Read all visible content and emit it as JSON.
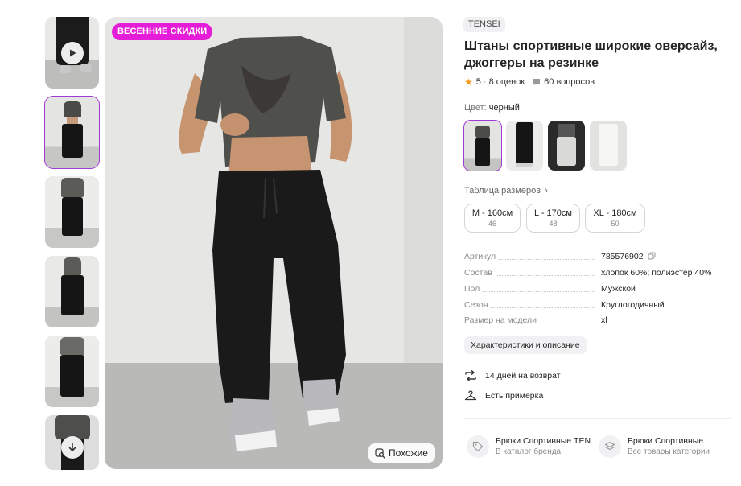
{
  "promo_badge": "ВЕСЕННИЕ СКИДКИ",
  "similar_button": "Похожие",
  "brand": "TENSEI",
  "title": "Штаны спортивные широкие оверсайз, джоггеры на резинке",
  "rating": {
    "value": "5",
    "reviews": "8 оценок",
    "questions": "60 вопросов"
  },
  "color": {
    "label": "Цвет:",
    "value": "черный"
  },
  "size_table_link": "Таблица размеров",
  "sizes": [
    {
      "label": "M - 160см",
      "ru": "46"
    },
    {
      "label": "L - 170см",
      "ru": "48"
    },
    {
      "label": "XL - 180см",
      "ru": "50"
    }
  ],
  "specs": [
    {
      "key": "Артикул",
      "value": "785576902"
    },
    {
      "key": "Состав",
      "value": "хлопок 60%; полиэстер 40%"
    },
    {
      "key": "Пол",
      "value": "Мужской"
    },
    {
      "key": "Сезон",
      "value": "Круглогодичный"
    },
    {
      "key": "Размер на модели",
      "value": "xl"
    }
  ],
  "characteristics_button": "Характеристики и описание",
  "features": [
    "14 дней на возврат",
    "Есть примерка"
  ],
  "cards": [
    {
      "title": "Брюки Спортивные TENSEI",
      "subtitle": "В каталог бренда"
    },
    {
      "title": "Брюки Спортивные",
      "subtitle": "Все товары категории"
    }
  ],
  "icons": {
    "play": "play-icon",
    "scroll_down": "arrow-down-icon",
    "similar": "search-image-icon",
    "star": "star-icon",
    "question": "chat-icon",
    "copy": "copy-icon",
    "return": "return-arrows-icon",
    "fitting": "hanger-icon",
    "tag": "tag-icon",
    "category": "layers-icon"
  },
  "colors": {
    "accent": "#a23bd6",
    "promo": "#e61dd8",
    "star": "#f49a1c"
  }
}
